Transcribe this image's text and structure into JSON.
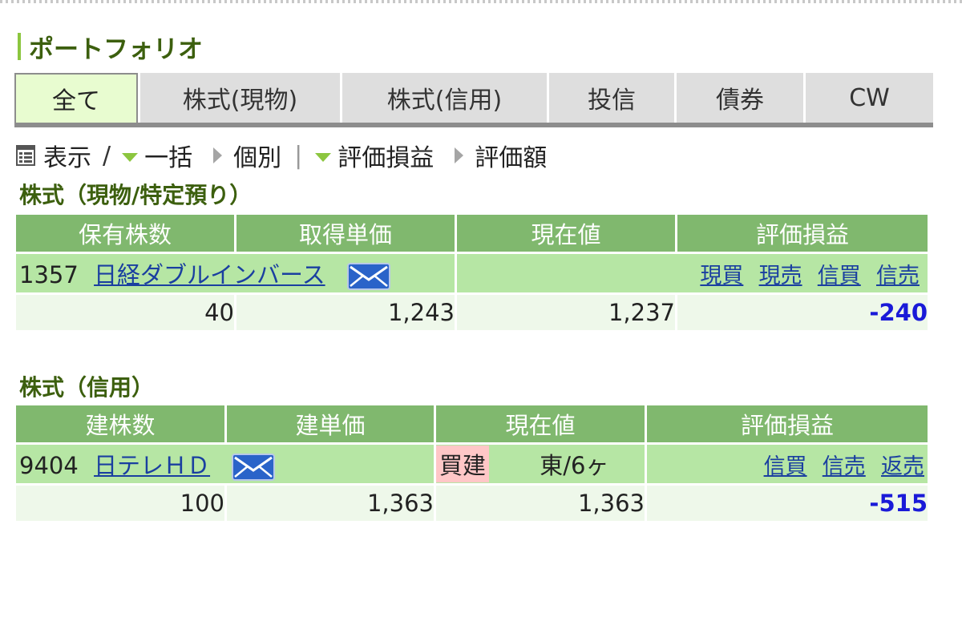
{
  "page_title": "ポートフォリオ",
  "tabs": [
    {
      "label": "全て",
      "active": true
    },
    {
      "label": "株式(現物)",
      "active": false
    },
    {
      "label": "株式(信用)",
      "active": false
    },
    {
      "label": "投信",
      "active": false
    },
    {
      "label": "債券",
      "active": false
    },
    {
      "label": "CW",
      "active": false
    }
  ],
  "toolbar": {
    "display_label": "表示",
    "separator": "/",
    "bulk_label": "一括",
    "individual_label": "個別",
    "pipe": "|",
    "pl_label": "評価損益",
    "value_label": "評価額"
  },
  "section_spot": {
    "title": "株式（現物/特定預り）",
    "headers": [
      "保有株数",
      "取得単価",
      "現在値",
      "評価損益"
    ],
    "rows": [
      {
        "code": "1357",
        "name": "日経ダブルインバース",
        "actions": [
          "現買",
          "現売",
          "信買",
          "信売"
        ],
        "shares": "40",
        "acquisition_price": "1,243",
        "current_price": "1,237",
        "profit_loss": "-240"
      }
    ]
  },
  "section_margin": {
    "title": "株式（信用）",
    "headers": [
      "建株数",
      "建単価",
      "現在値",
      "評価損益"
    ],
    "rows": [
      {
        "code": "9404",
        "name": "日テレＨＤ",
        "position_type": "買建",
        "market": "東/6ヶ",
        "actions": [
          "信買",
          "信売",
          "返売"
        ],
        "shares": "100",
        "position_price": "1,363",
        "current_price": "1,363",
        "profit_loss": "-515"
      }
    ]
  },
  "colors": {
    "title_green": "#3c5f0e",
    "header_green": "#80b86e",
    "name_row_green": "#b6e6a4",
    "value_row": "#eef8ea",
    "negative_pl": "#1a1ad8",
    "link_blue": "#1a3fa0",
    "buy_position_bg": "#ffc7c7"
  },
  "icons": [
    "list-icon",
    "mail-icon",
    "triangle-down-icon",
    "triangle-right-icon"
  ]
}
